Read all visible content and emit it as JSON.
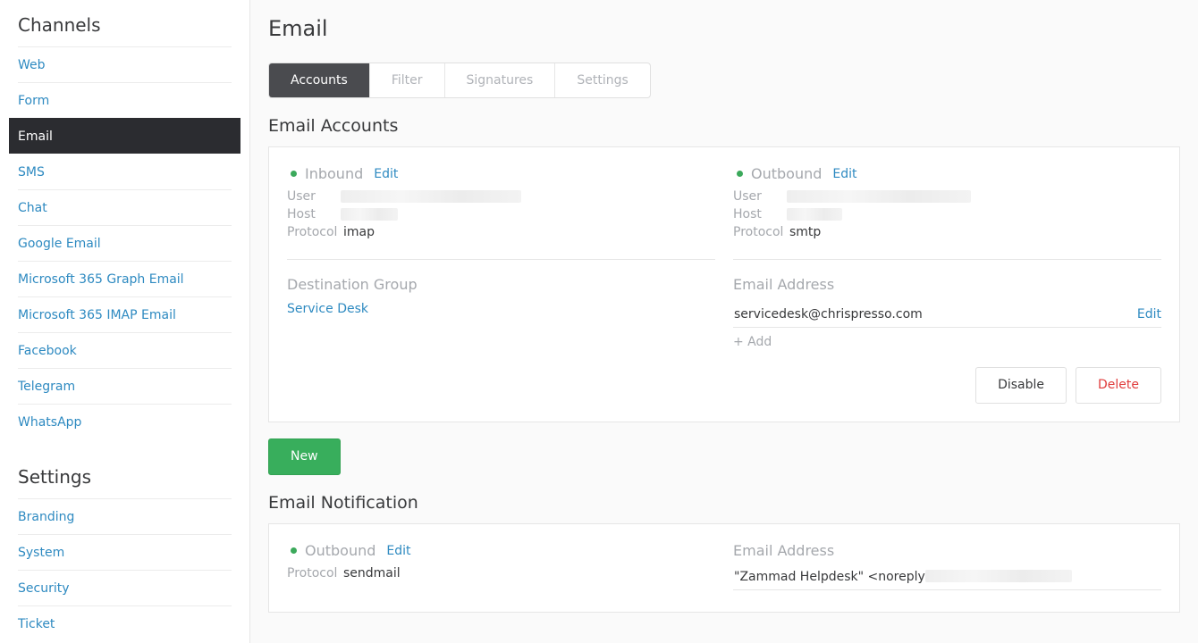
{
  "sidebar": {
    "channels_heading": "Channels",
    "channels": [
      {
        "label": "Web"
      },
      {
        "label": "Form"
      },
      {
        "label": "Email"
      },
      {
        "label": "SMS"
      },
      {
        "label": "Chat"
      },
      {
        "label": "Google Email"
      },
      {
        "label": "Microsoft 365 Graph Email"
      },
      {
        "label": "Microsoft 365 IMAP Email"
      },
      {
        "label": "Facebook"
      },
      {
        "label": "Telegram"
      },
      {
        "label": "WhatsApp"
      }
    ],
    "settings_heading": "Settings",
    "settings": [
      {
        "label": "Branding"
      },
      {
        "label": "System"
      },
      {
        "label": "Security"
      },
      {
        "label": "Ticket"
      }
    ]
  },
  "main": {
    "title": "Email",
    "tabs": [
      {
        "label": "Accounts"
      },
      {
        "label": "Filter"
      },
      {
        "label": "Signatures"
      },
      {
        "label": "Settings"
      }
    ],
    "accounts_title": "Email Accounts",
    "inbound": {
      "label": "Inbound",
      "edit": "Edit",
      "user_key": "User",
      "host_key": "Host",
      "protocol_key": "Protocol",
      "protocol": "imap"
    },
    "outbound": {
      "label": "Outbound",
      "edit": "Edit",
      "user_key": "User",
      "host_key": "Host",
      "protocol_key": "Protocol",
      "protocol": "smtp"
    },
    "destination_group_label": "Destination Group",
    "destination_group": "Service Desk",
    "email_address_label": "Email Address",
    "email_address": "servicedesk@chrispresso.com",
    "email_edit": "Edit",
    "add": "+ Add",
    "disable": "Disable",
    "delete": "Delete",
    "new": "New",
    "notification_title": "Email Notification",
    "notification": {
      "label": "Outbound",
      "edit": "Edit",
      "protocol_key": "Protocol",
      "protocol": "sendmail",
      "email_address_label": "Email Address",
      "email_address": "\"Zammad Helpdesk\" <noreply"
    }
  },
  "colors": {
    "accent": "#2e8ac1",
    "active_nav": "#2b2c30",
    "status_ok": "#3ba95b",
    "primary_button": "#38ae5c",
    "danger": "#e03c3c"
  }
}
